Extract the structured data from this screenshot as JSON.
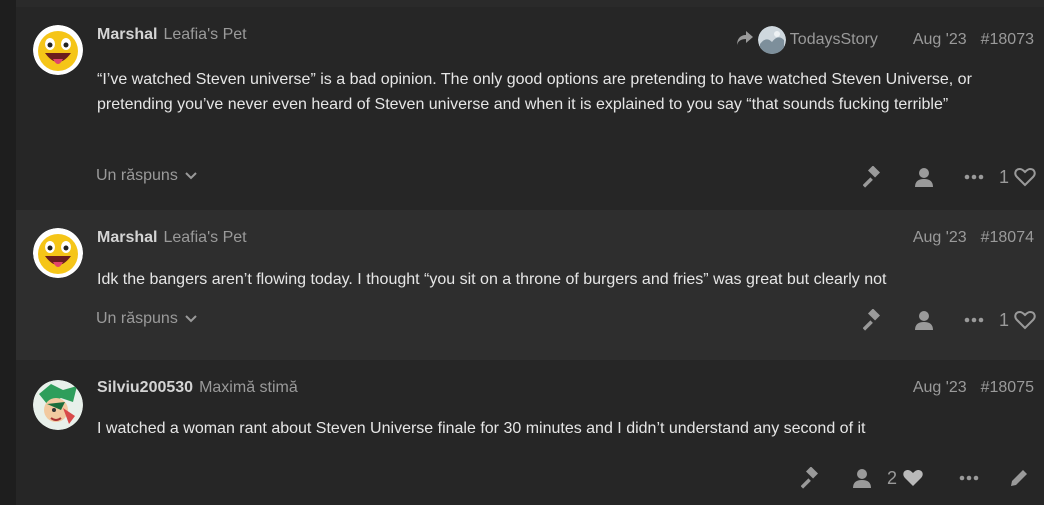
{
  "posts": [
    {
      "username": "Marshal",
      "user_title": "Leafia's Pet",
      "reply_to": "TodaysStory",
      "date": "Aug '23",
      "post_number": "#18073",
      "body": "“I’ve watched Steven universe” is a bad opinion. The only good options are pretending to have watched Steven Universe, or pretending you’ve never even heard of Steven universe and when it is explained to you say “that sounds fucking terrible”",
      "replies_label": "Un răspuns",
      "likes": "1"
    },
    {
      "username": "Marshal",
      "user_title": "Leafia's Pet",
      "date": "Aug '23",
      "post_number": "#18074",
      "body": "Idk the bangers aren’t flowing today. I thought “you sit on a throne of burgers and fries” was great but clearly not",
      "replies_label": "Un răspuns",
      "likes": "1"
    },
    {
      "username": "Silviu200530",
      "user_title": "Maximă stimă",
      "date": "Aug '23",
      "post_number": "#18075",
      "body": "I watched a woman rant about Steven Universe finale for 30 minutes and I didn’t understand any second of it",
      "likes": "2"
    }
  ]
}
